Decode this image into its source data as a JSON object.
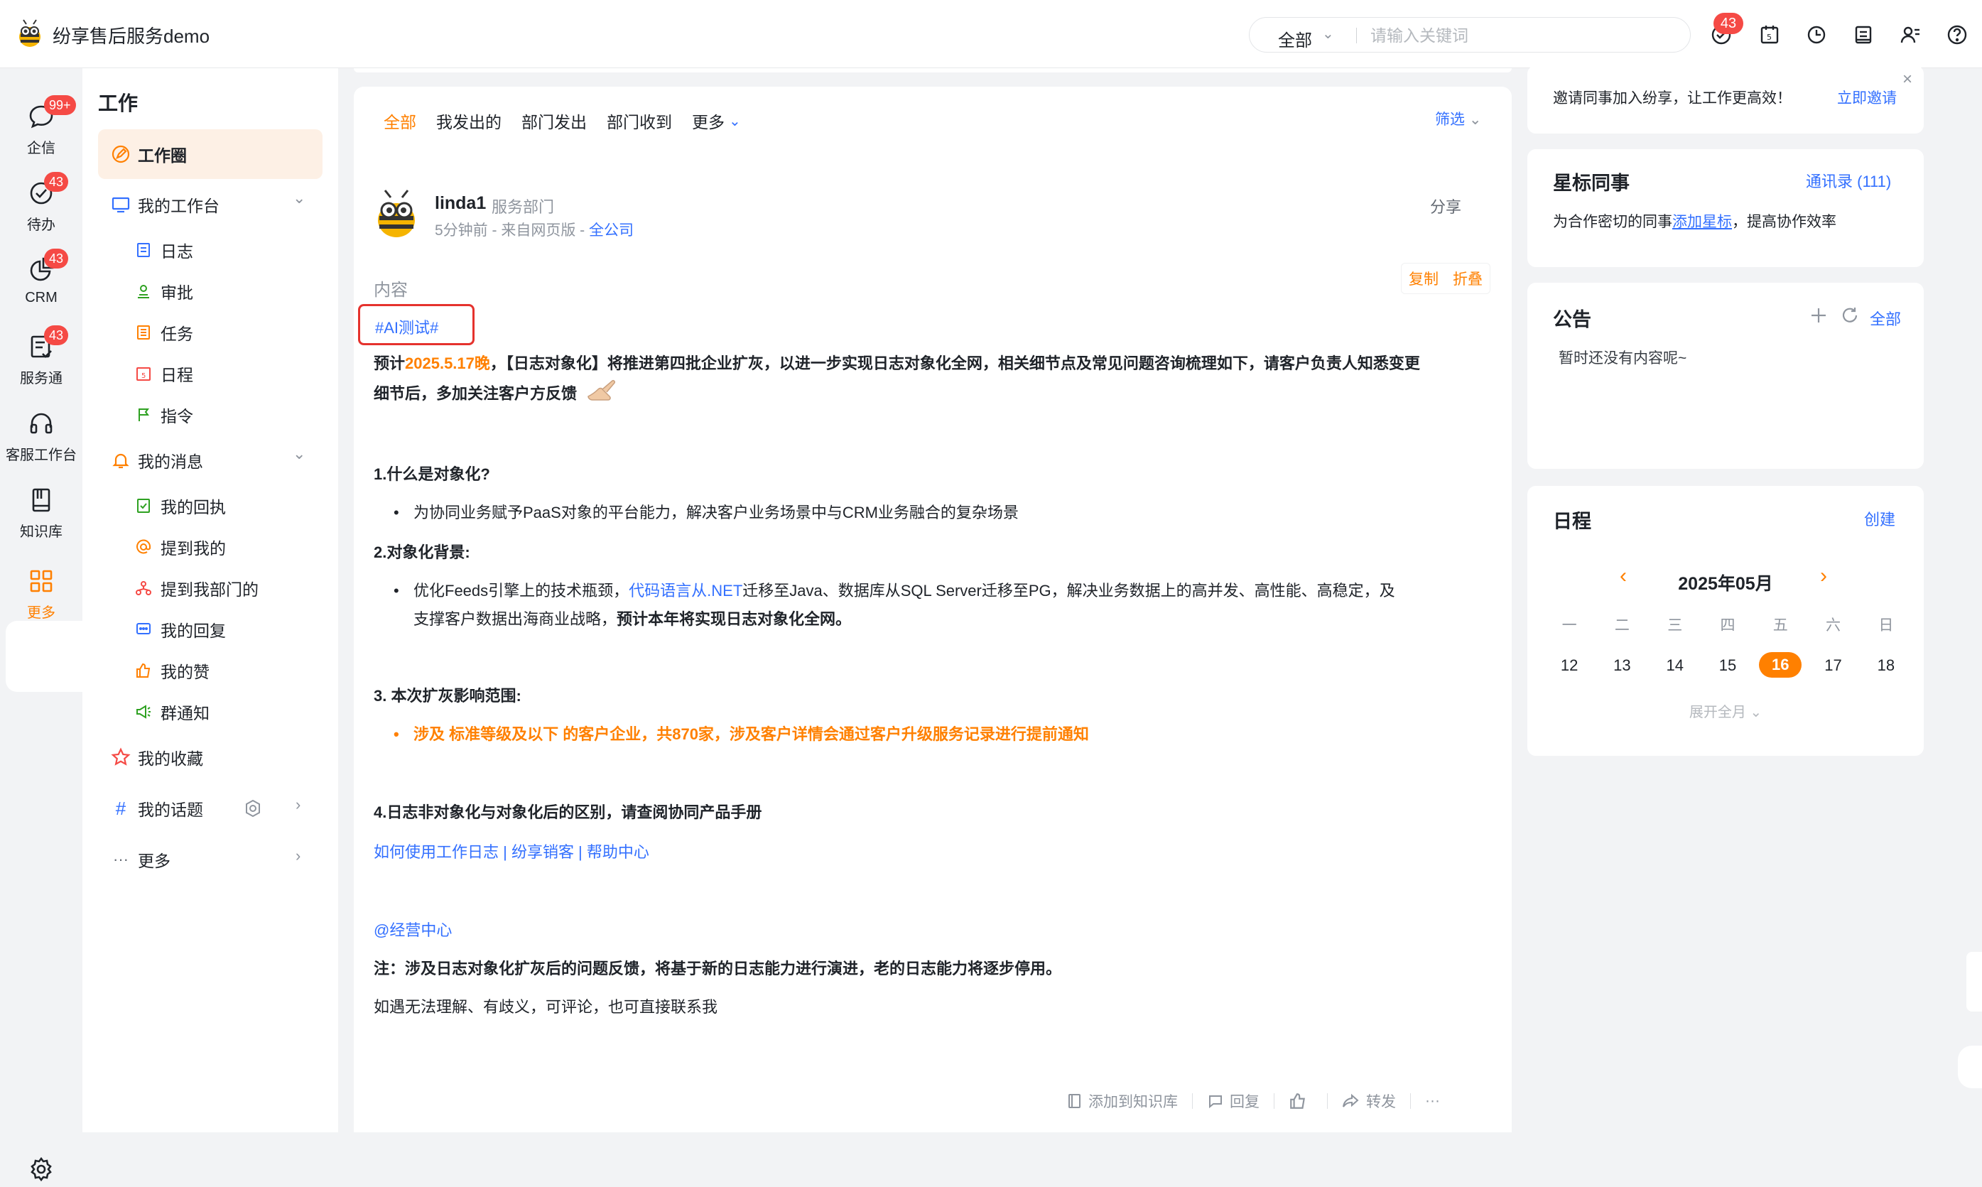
{
  "app": {
    "title": "纷享售后服务demo"
  },
  "topbar": {
    "search_scope": "全部",
    "search_placeholder": "请输入关键词",
    "notification_count": "43"
  },
  "rail": {
    "items": [
      {
        "label": "企信",
        "badge": "99+"
      },
      {
        "label": "待办",
        "badge": "43"
      },
      {
        "label": "CRM",
        "badge": "43"
      },
      {
        "label": "服务通",
        "badge": "43"
      },
      {
        "label": "客服工作台",
        "badge": ""
      },
      {
        "label": "知识库",
        "badge": ""
      },
      {
        "label": "更多",
        "badge": ""
      }
    ]
  },
  "sidenav": {
    "title": "工作",
    "work_circle": "工作圈",
    "workbench": "我的工作台",
    "workbench_items": [
      "日志",
      "审批",
      "任务",
      "日程",
      "指令"
    ],
    "messages": "我的消息",
    "message_items": [
      "我的回执",
      "提到我的",
      "提到我部门的",
      "我的回复",
      "我的赞",
      "群通知"
    ],
    "favorites": "我的收藏",
    "topics": "我的话题",
    "more": "更多"
  },
  "feed": {
    "tabs": [
      "全部",
      "我发出的",
      "部门发出",
      "部门收到",
      "更多"
    ],
    "filter": "筛选",
    "post": {
      "author": "linda1",
      "dept": "服务部门",
      "meta_prefix": "5分钟前 - 来自网页版 - ",
      "meta_scope": "全公司",
      "share": "分享",
      "content_label": "内容",
      "copy": "复制",
      "fold": "折叠",
      "hashtag": "#AI测试#",
      "intro_pre": "预计",
      "intro_date": "2025.5.17晚",
      "intro_rest": "，【日志对象化】将推进第四批企业扩灰，以进一步实现日志对象化全网，相关细节点及常见问题咨询梳理如下，请客户负责人知悉变更",
      "intro_line2": "细节后，多加关注客户方反馈",
      "h1": "1.什么是对象化?",
      "h1_bullet": "为协同业务赋予PaaS对象的平台能力，解决客户业务场景中与CRM业务融合的复杂场景",
      "h2": "2.对象化背景:",
      "h2_bullet_pre": "优化Feeds引擎上的技术瓶颈，",
      "h2_bullet_link": "代码语言从.NET",
      "h2_bullet_rest": "迁移至Java、数据库从SQL Server迁移至PG，解决业务数据上的高并发、高性能、高稳定，及",
      "h2_bullet_line2_pre": "支撑客户数据出海商业战略，",
      "h2_bullet_line2_bold": "预计本年将实现日志对象化全网。",
      "h3": "3. 本次扩灰影响范围:",
      "h3_bullet": "涉及 标准等级及以下 的客户企业，共870家，涉及客户详情会通过客户升级服务记录进行提前通知",
      "h4": "4.日志非对象化与对象化后的区别，请查阅协同产品手册",
      "links_line": "如何使用工作日志 | 纷享销客 | 帮助中心",
      "mention": "@经营中心",
      "note": "注：涉及日志对象化扩灰后的问题反馈，将基于新的日志能力进行演进，老的日志能力将逐步停用。",
      "footer": "如遇无法理解、有歧义，可评论，也可直接联系我"
    },
    "actions": {
      "add_kb": "添加到知识库",
      "reply": "回复",
      "forward": "转发",
      "more": "···"
    }
  },
  "right": {
    "invite_text": "邀请同事加入纷享，让工作更高效！",
    "invite_link": "立即邀请",
    "starred_title": "星标同事",
    "contacts_link": "通讯录 (111)",
    "starred_text_pre": "为合作密切的同事",
    "starred_text_link": "添加星标",
    "starred_text_post": "，提高协作效率",
    "notice_title": "公告",
    "notice_all": "全部",
    "notice_empty": "暂时还没有内容呢~",
    "schedule_title": "日程",
    "schedule_create": "创建",
    "calendar": {
      "month": "2025年05月",
      "weekdays": [
        "一",
        "二",
        "三",
        "四",
        "五",
        "六",
        "日"
      ],
      "days": [
        "12",
        "13",
        "14",
        "15",
        "16",
        "17",
        "18"
      ],
      "today_index": 4,
      "expand": "展开全月"
    }
  },
  "colors": {
    "accent": "#ff8000",
    "link": "#3370ff",
    "badge": "#f54a45",
    "highlight_border": "#e5322d"
  }
}
